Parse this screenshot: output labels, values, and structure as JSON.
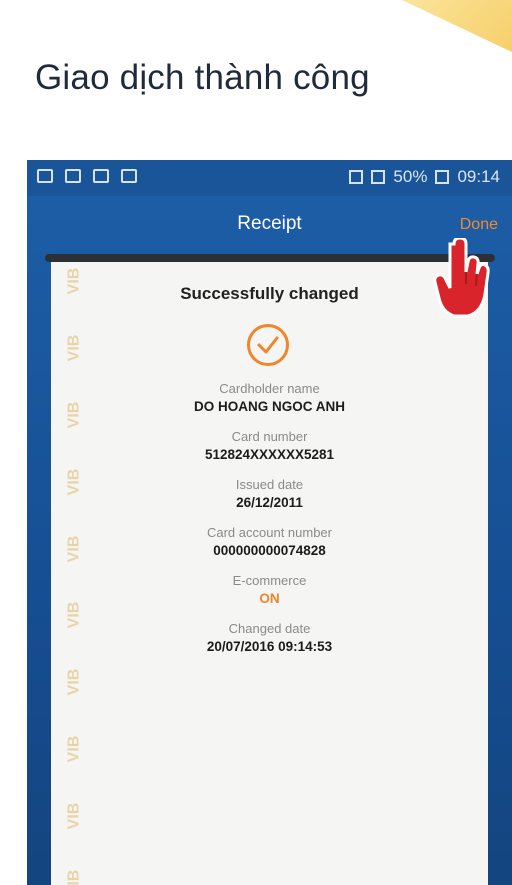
{
  "headline": "Giao dịch thành công",
  "status_bar": {
    "battery": "50%",
    "time": "09:14"
  },
  "app_bar": {
    "title": "Receipt",
    "done_label": "Done"
  },
  "watermark_text": "VIB",
  "receipt": {
    "heading": "Successfully changed",
    "fields": [
      {
        "label": "Cardholder name",
        "value": "DO HOANG NGOC ANH"
      },
      {
        "label": "Card number",
        "value": "512824XXXXXX5281"
      },
      {
        "label": "Issued date",
        "value": "26/12/2011"
      },
      {
        "label": "Card account number",
        "value": "000000000074828"
      },
      {
        "label": "E-commerce",
        "value": "ON"
      },
      {
        "label": "Changed date",
        "value": "20/07/2016 09:14:53"
      }
    ]
  },
  "colors": {
    "accent": "#f0852a",
    "brand_blue": "#1a5499",
    "headline": "#1f2b3a"
  },
  "icons": [
    "check-circle-icon",
    "pointer-hand-icon",
    "wifi-icon",
    "signal-icon",
    "battery-icon"
  ]
}
